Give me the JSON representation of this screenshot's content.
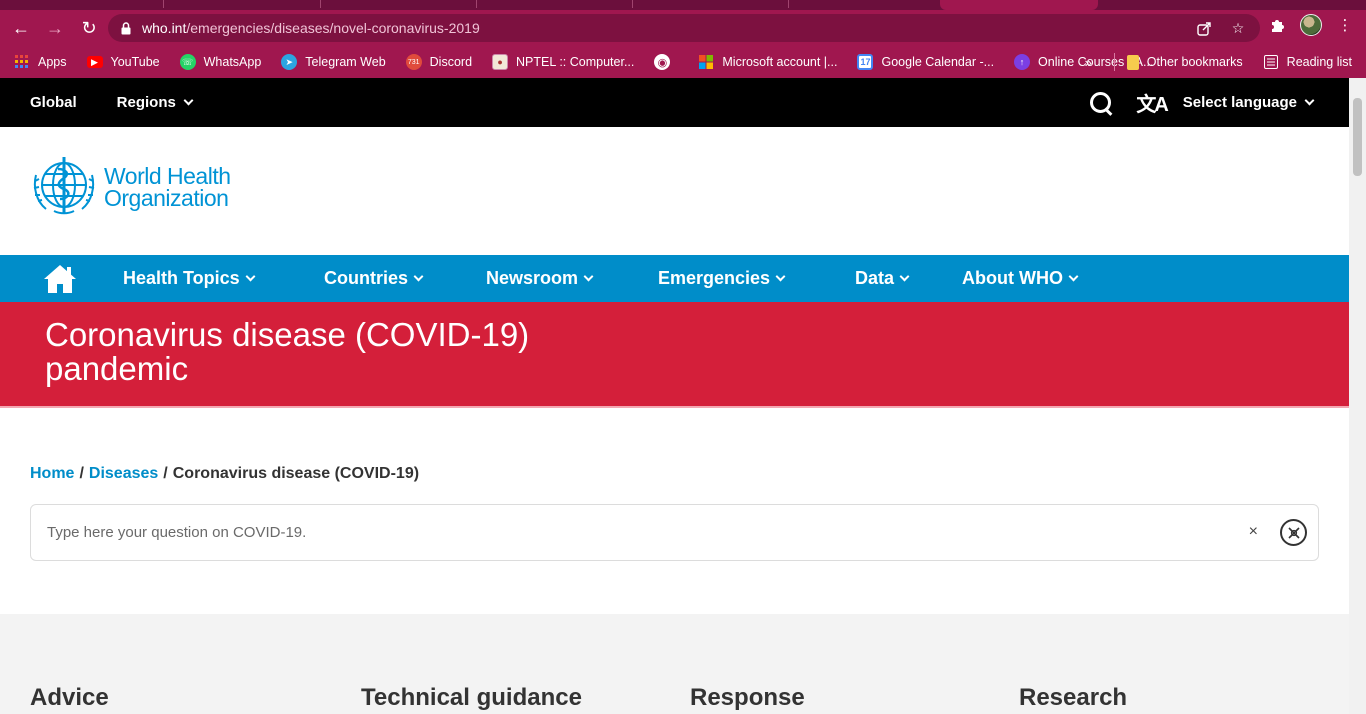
{
  "browser": {
    "url_host": "who.int",
    "url_path": "/emergencies/diseases/novel-coronavirus-2019",
    "bookmarks": [
      {
        "label": "Apps",
        "icon": "apps-grid-icon",
        "color": "#e8453c"
      },
      {
        "label": "YouTube",
        "icon": "youtube-icon",
        "color": "#ff0000"
      },
      {
        "label": "WhatsApp",
        "icon": "whatsapp-icon",
        "color": "#25d366"
      },
      {
        "label": "Telegram Web",
        "icon": "telegram-icon",
        "color": "#2ca5e0"
      },
      {
        "label": "Discord",
        "icon": "discord-icon",
        "color": "#e04b3c"
      },
      {
        "label": "NPTEL :: Computer...",
        "icon": "nptel-icon",
        "color": "#e8e0d0"
      },
      {
        "label": "",
        "icon": "globe-icon",
        "color": "#ffffff"
      },
      {
        "label": "Microsoft account |...",
        "icon": "microsoft-icon",
        "color": "#f25022"
      },
      {
        "label": "Google Calendar -...",
        "icon": "calendar-icon",
        "color": "#4285f4"
      },
      {
        "label": "Online Courses - A...",
        "icon": "course-icon",
        "color": "#7b3fe4"
      }
    ],
    "bookmarks_more": "»",
    "other_bookmarks": "Other bookmarks",
    "reading_list": "Reading list"
  },
  "topbar": {
    "global": "Global",
    "regions": "Regions",
    "select_language": "Select language",
    "translate_icon": "文A"
  },
  "logo": {
    "line1": "World Health",
    "line2": "Organization"
  },
  "mainnav": {
    "items": [
      "Health Topics",
      "Countries",
      "Newsroom",
      "Emergencies",
      "Data",
      "About WHO"
    ]
  },
  "banner": {
    "title": "Coronavirus disease (COVID-19) pandemic"
  },
  "breadcrumb": {
    "home": "Home",
    "separator": "/",
    "diseases": "Diseases",
    "current": "Coronavirus disease (COVID-19)"
  },
  "question": {
    "placeholder": "Type here your question on COVID-19.",
    "clear": "×"
  },
  "sections": [
    "Advice",
    "Technical guidance",
    "Response",
    "Research"
  ],
  "colors": {
    "browser_chrome": "#a0174f",
    "who_blue": "#008dc9",
    "banner_red": "#d41f3a"
  }
}
